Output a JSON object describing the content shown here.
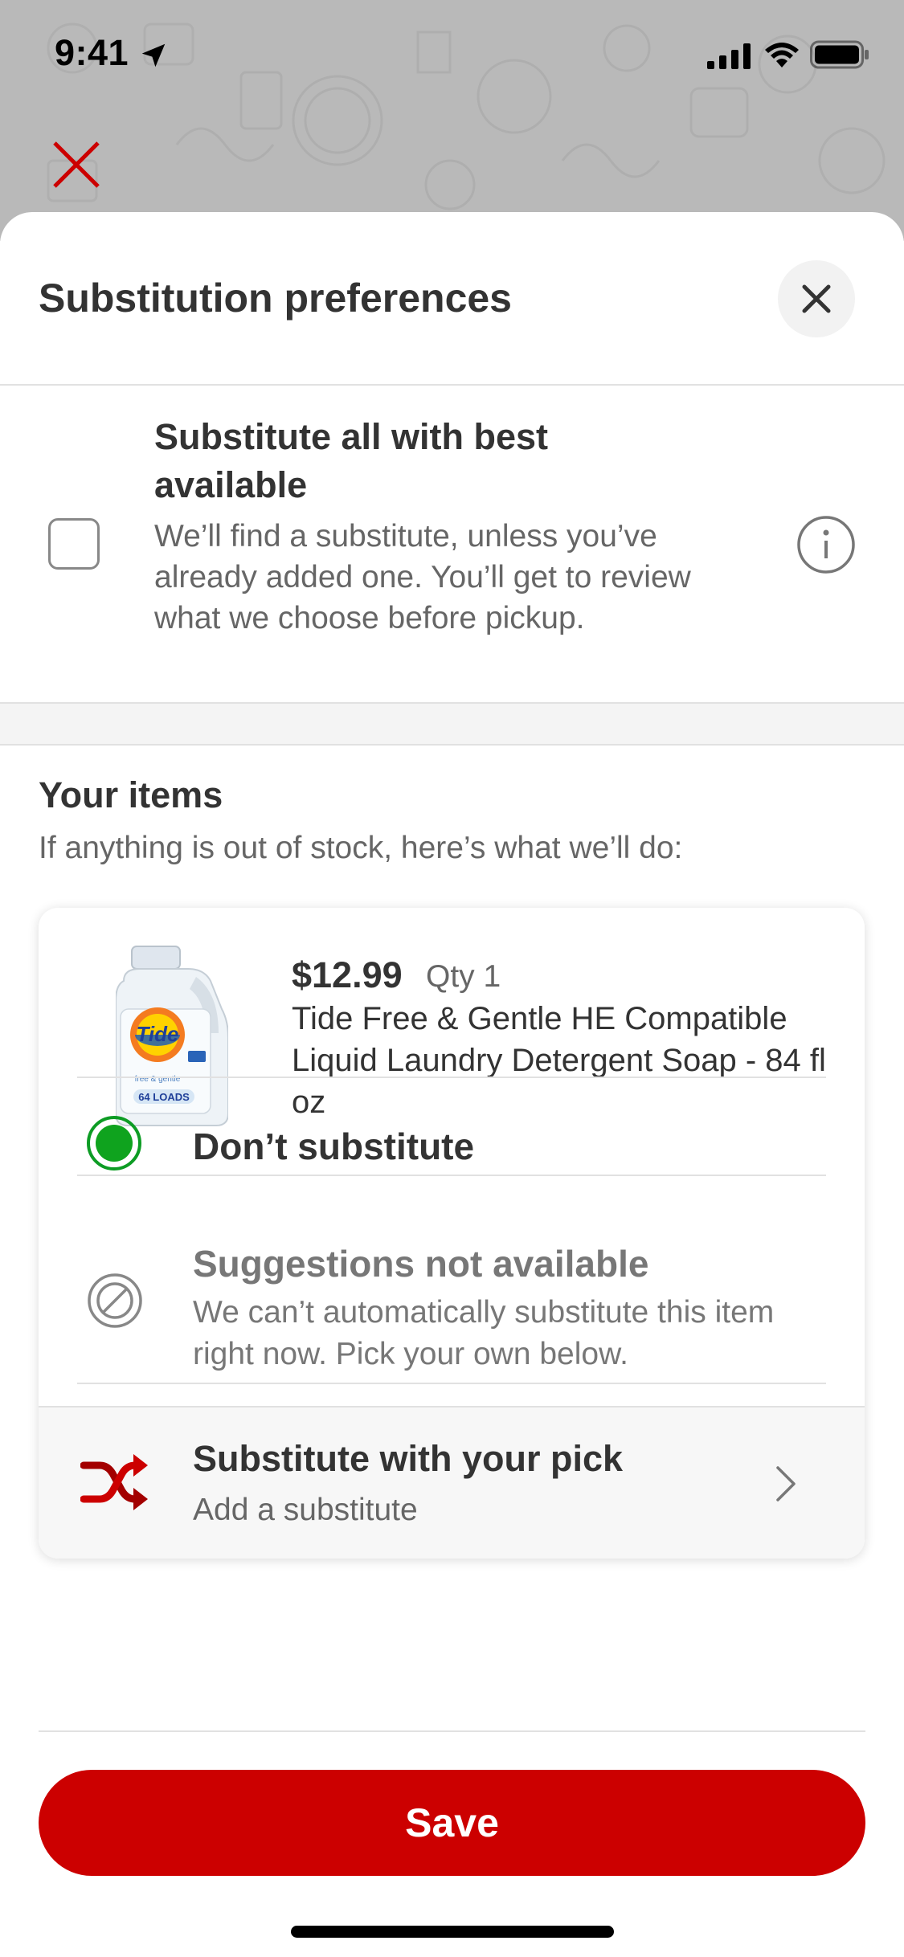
{
  "status_bar": {
    "time": "9:41",
    "icons": [
      "location-arrow-icon",
      "cellular-signal-icon",
      "wifi-icon",
      "battery-icon"
    ]
  },
  "background": {
    "close_icon": "close-x-icon",
    "close_color": "#cc0000"
  },
  "sheet": {
    "title": "Substitution preferences",
    "close_icon": "close-x-icon"
  },
  "substitute_all": {
    "title": "Substitute all with best available",
    "description": "We’ll find a substitute, unless you’ve already added one. You’ll get to review what we choose before pickup.",
    "checked": false,
    "info_icon": "info-icon"
  },
  "items": {
    "title": "Your items",
    "subtitle": "If anything is out of stock, here’s what we’ll do:",
    "list": [
      {
        "price": "$12.99",
        "qty": "Qty 1",
        "name": "Tide Free & Gentle HE Compatible Liquid Laundry Detergent Soap - 84 fl oz",
        "image_icon": "detergent-bottle-image",
        "options": {
          "dont_substitute": {
            "label": "Don’t substitute",
            "selected": true
          },
          "suggestions": {
            "title": "Suggestions not available",
            "description": "We can’t automatically substitute this item right now. Pick your own below."
          },
          "your_pick": {
            "title": "Substitute with your pick",
            "subtitle": "Add a substitute",
            "icon": "shuffle-icon"
          }
        }
      }
    ]
  },
  "footer": {
    "save_label": "Save"
  },
  "colors": {
    "brand_red": "#cc0000",
    "selected_green": "#0fa31e",
    "text_primary": "#333333",
    "text_secondary": "#666666"
  }
}
